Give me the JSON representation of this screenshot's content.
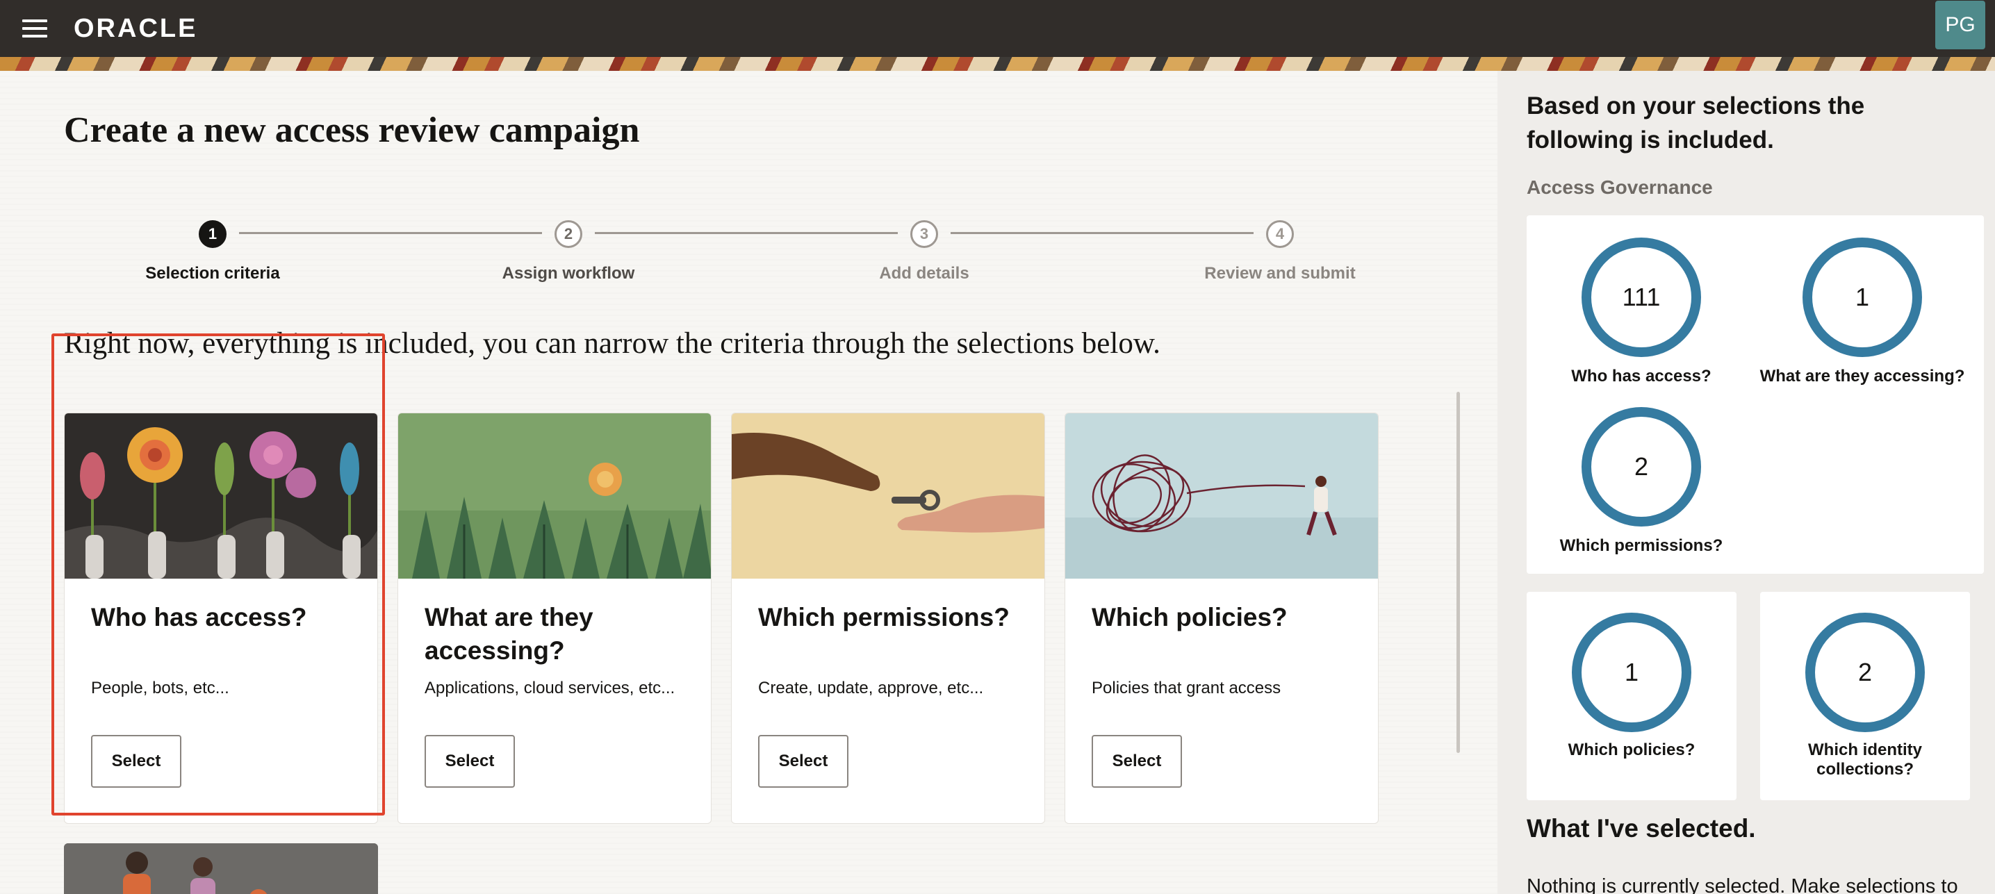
{
  "header": {
    "brand": "ORACLE",
    "avatar_initials": "PG"
  },
  "page": {
    "title": "Create a new access review campaign",
    "subtitle": "Right now, everything is included, you can narrow the criteria through the selections below."
  },
  "stepper": {
    "steps": [
      {
        "number": "1",
        "label": "Selection criteria",
        "state": "active"
      },
      {
        "number": "2",
        "label": "Assign workflow",
        "state": "upcoming"
      },
      {
        "number": "3",
        "label": "Add details",
        "state": "disabled"
      },
      {
        "number": "4",
        "label": "Review and submit",
        "state": "disabled"
      }
    ]
  },
  "cards": [
    {
      "title": "Who has access?",
      "description": "People, bots, etc...",
      "button": "Select",
      "selected": true
    },
    {
      "title": "What are they accessing?",
      "description": "Applications, cloud services, etc...",
      "button": "Select",
      "selected": false
    },
    {
      "title": "Which permissions?",
      "description": "Create, update, approve, etc...",
      "button": "Select",
      "selected": false
    },
    {
      "title": "Which policies?",
      "description": "Policies that grant access",
      "button": "Select",
      "selected": false
    }
  ],
  "panel": {
    "heading": "Based on your selections the following is included.",
    "section": "Access Governance",
    "stats": [
      {
        "value": "111",
        "label": "Who has access?"
      },
      {
        "value": "1",
        "label": "What are they accessing?"
      },
      {
        "value": "2",
        "label": "Which permissions?"
      },
      {
        "value": "1",
        "label": "Which policies?"
      },
      {
        "value": "2",
        "label": "Which identity collections?"
      }
    ],
    "selected_heading": "What I've selected.",
    "selected_text": "Nothing is currently selected. Make selections to"
  },
  "colors": {
    "header_bg": "#312d2a",
    "ring": "#357ba1",
    "selected_outline": "#e0442e"
  }
}
